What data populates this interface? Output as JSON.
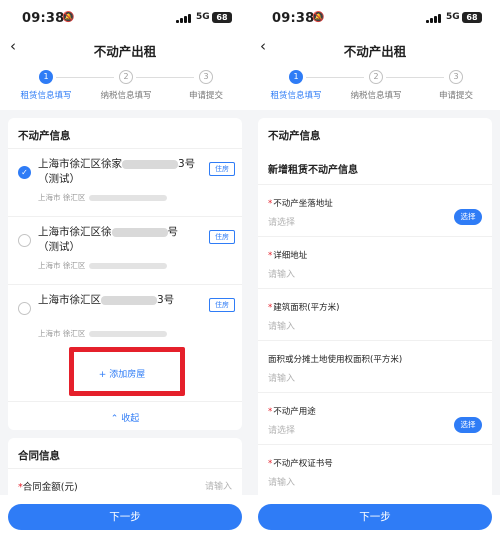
{
  "screens": {
    "left": {
      "status": {
        "time": "09:38",
        "network": "5G",
        "battery": "68"
      },
      "nav": {
        "title": "不动产出租"
      },
      "steps": [
        {
          "num": "1",
          "label": "租赁信息填写"
        },
        {
          "num": "2",
          "label": "纳税信息填写"
        },
        {
          "num": "3",
          "label": "申请提交"
        }
      ],
      "property_section": {
        "title": "不动产信息",
        "items": [
          {
            "addr_prefix": "上海市徐汇区徐家",
            "addr_suffix": "3号（测试）",
            "sub": "上海市 徐汇区",
            "tag": "住房",
            "selected": true
          },
          {
            "addr_prefix": "上海市徐汇区徐",
            "addr_suffix": "号（测试）",
            "sub": "上海市 徐汇区",
            "tag": "住房",
            "selected": false
          },
          {
            "addr_prefix": "上海市徐汇区",
            "addr_suffix": "3号",
            "sub": "上海市 徐汇区",
            "tag": "住房",
            "selected": false
          }
        ],
        "add_button": "+ 添加房屋",
        "collapse": "收起"
      },
      "contract_section": {
        "title": "合同信息",
        "amount_label": "合同金额(元)",
        "amount_placeholder": "请输入"
      },
      "next_button": "下一步"
    },
    "right": {
      "status": {
        "time": "09:38",
        "network": "5G",
        "battery": "68"
      },
      "nav": {
        "title": "不动产出租"
      },
      "steps": [
        {
          "num": "1",
          "label": "租赁信息填写"
        },
        {
          "num": "2",
          "label": "纳税信息填写"
        },
        {
          "num": "3",
          "label": "申请提交"
        }
      ],
      "section_title": "不动产信息",
      "form_title": "新增租赁不动产信息",
      "fields": [
        {
          "label": "不动产坐落地址",
          "required": true,
          "placeholder": "请选择",
          "button": "选择"
        },
        {
          "label": "详细地址",
          "required": true,
          "placeholder": "请输入"
        },
        {
          "label": "建筑面积(平方米)",
          "required": true,
          "placeholder": "请输入"
        },
        {
          "label": "面积或分摊土地使用权面积(平方米)",
          "required": false,
          "placeholder": "请输入"
        },
        {
          "label": "不动产用途",
          "required": true,
          "placeholder": "请选择",
          "button": "选择"
        },
        {
          "label": "不动产权证书号",
          "required": true,
          "placeholder": "请输入"
        }
      ],
      "next_button": "下一步"
    }
  },
  "colors": {
    "accent": "#2f7cf6",
    "highlight": "#e5202b",
    "background": "#f4f5f7"
  }
}
